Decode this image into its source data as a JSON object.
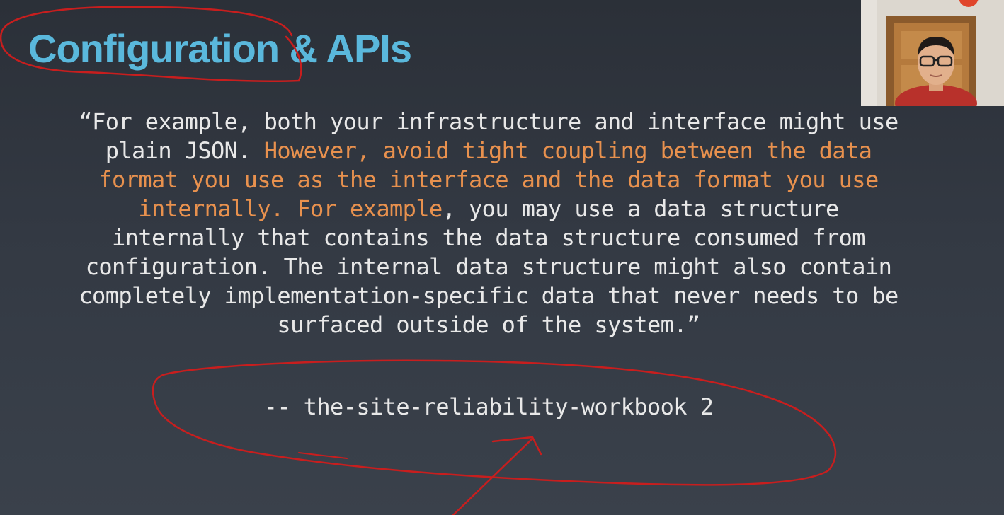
{
  "slide": {
    "title": "Configuration & APIs",
    "quote": {
      "line1": "“For example, both your infrastructure and interface might use",
      "line2_plain": "plain JSON. ",
      "line2_highlight": "However, avoid tight coupling between the data",
      "line3_highlight": "format you use as the interface and the data format you use",
      "line4_highlight": "internally. For example",
      "line4_plain": ", you may use a data structure",
      "line5": "internally that contains the data structure consumed from",
      "line6": "configuration. The internal data structure might also contain",
      "line7": "completely implementation-specific data that never needs to be",
      "line8": "surfaced outside of the system.”"
    },
    "attribution": "-- the-site-reliability-workbook 2"
  },
  "colors": {
    "title": "#5ab8dc",
    "body_text": "#e8e8e8",
    "highlight_text": "#e8914e",
    "annotation_ink": "#c81e1e"
  },
  "webcam": {
    "icon": "person-video-feed"
  }
}
